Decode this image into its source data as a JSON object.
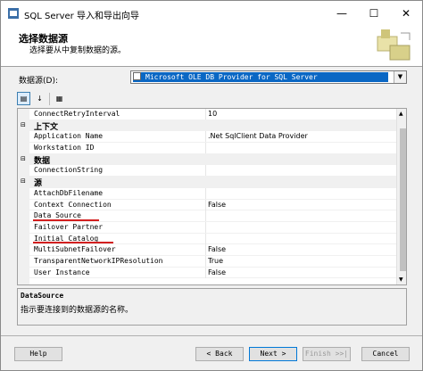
{
  "window": {
    "title": "SQL Server 导入和导出向导",
    "minimize_glyph": "—",
    "maximize_glyph": "☐",
    "close_glyph": "✕"
  },
  "header": {
    "title": "选择数据源",
    "subtitle": "选择要从中复制数据的源。"
  },
  "datasource": {
    "label": "数据源(D):",
    "selected": "Microsoft OLE DB Provider for SQL Server",
    "arrow": "▼"
  },
  "toolbar": {
    "categorized_glyph": "▤",
    "alphabetical_glyph": "↓",
    "properties_glyph": "▦"
  },
  "grid": {
    "rows": [
      {
        "kind": "prop",
        "name": "ConnectRetryInterval",
        "value": "10"
      },
      {
        "kind": "cat",
        "toggle": "⊟",
        "name": "上下文"
      },
      {
        "kind": "prop",
        "name": "Application Name",
        "value": ".Net SqlClient Data Provider"
      },
      {
        "kind": "prop",
        "name": "Workstation ID",
        "value": ""
      },
      {
        "kind": "cat",
        "toggle": "⊟",
        "name": "数据"
      },
      {
        "kind": "prop",
        "name": "ConnectionString",
        "value": ""
      },
      {
        "kind": "cat",
        "toggle": "⊟",
        "name": "源"
      },
      {
        "kind": "prop",
        "name": "AttachDbFilename",
        "value": ""
      },
      {
        "kind": "prop",
        "name": "Context Connection",
        "value": "False"
      },
      {
        "kind": "prop",
        "name": "Data Source",
        "value": ""
      },
      {
        "kind": "prop",
        "name": "Failover Partner",
        "value": ""
      },
      {
        "kind": "prop",
        "name": "Initial Catalog",
        "value": ""
      },
      {
        "kind": "prop",
        "name": "MultiSubnetFailover",
        "value": "False"
      },
      {
        "kind": "prop",
        "name": "TransparentNetworkIPResolution",
        "value": "True"
      },
      {
        "kind": "prop",
        "name": "User Instance",
        "value": "False"
      }
    ]
  },
  "description": {
    "title": "DataSource",
    "text": "指示要连接到的数据源的名称。"
  },
  "buttons": {
    "help": "Help",
    "back": "< Back",
    "next": "Next >",
    "finish": "Finish >>|",
    "cancel": "Cancel"
  },
  "colors": {
    "selection": "#0a67c4",
    "annotation_red": "#d21f1f",
    "focus_border": "#0078d7"
  }
}
